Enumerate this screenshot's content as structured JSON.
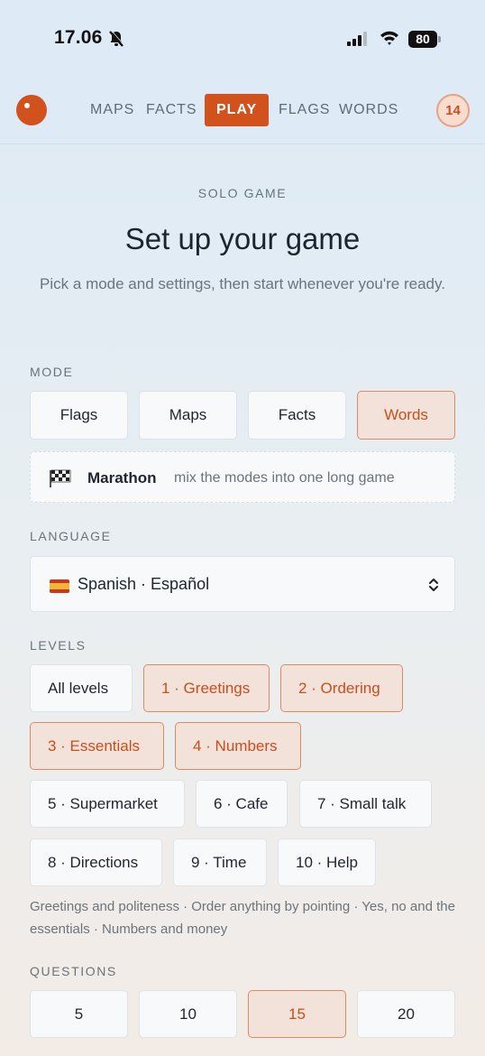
{
  "status_bar": {
    "time": "17.06",
    "battery": "80"
  },
  "nav": {
    "items": [
      "MAPS",
      "FACTS",
      "PLAY",
      "FLAGS",
      "WORDS"
    ],
    "active": "PLAY",
    "badge": "14"
  },
  "header": {
    "eyebrow": "SOLO GAME",
    "title": "Set up your game",
    "subtitle": "Pick a mode and settings, then start whenever you're ready."
  },
  "mode": {
    "label": "MODE",
    "options": [
      "Flags",
      "Maps",
      "Facts",
      "Words"
    ],
    "selected": "Words",
    "marathon": {
      "title": "Marathon",
      "description": "mix the modes into one long game"
    }
  },
  "language": {
    "label": "LANGUAGE",
    "selected": "Spanish · Español"
  },
  "levels": {
    "label": "LEVELS",
    "options": [
      "All levels",
      "1 · Greetings",
      "2 · Ordering",
      "3 · Essentials",
      "4 · Numbers",
      "5 · Supermarket",
      "6 · Cafe",
      "7 · Small talk",
      "8 · Directions",
      "9 · Time",
      "10 · Help"
    ],
    "selected": [
      "1 · Greetings",
      "2 · Ordering",
      "3 · Essentials",
      "4 · Numbers"
    ],
    "note": "Greetings and politeness · Order anything by pointing · Yes, no and the essentials · Numbers and money"
  },
  "questions": {
    "label": "QUESTIONS",
    "options": [
      "5",
      "10",
      "15",
      "20"
    ],
    "selected": "15"
  },
  "colors": {
    "accent": "#d1521c",
    "selected_bg": "#f3e2d9",
    "selected_border": "#dd8a63"
  }
}
